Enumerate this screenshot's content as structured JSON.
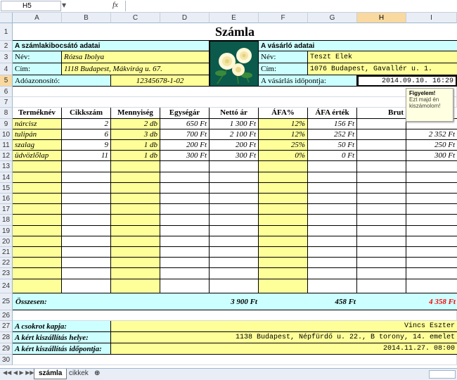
{
  "namebox": "H5",
  "fx": "fx",
  "columns": [
    "A",
    "B",
    "C",
    "D",
    "E",
    "F",
    "G",
    "H",
    "I"
  ],
  "rows": [
    "1",
    "2",
    "3",
    "4",
    "5",
    "6",
    "7",
    "8",
    "9",
    "10",
    "11",
    "12",
    "13",
    "14",
    "15",
    "16",
    "17",
    "18",
    "19",
    "20",
    "21",
    "22",
    "23",
    "24",
    "25",
    "26",
    "27",
    "28",
    "29",
    "30"
  ],
  "title": "Számla",
  "seller": {
    "header": "A számlakibocsátó adatai",
    "name_label": "Név:",
    "name": "Rózsa Ibolya",
    "address_label": "Cím:",
    "address": "1118 Budapest, Mákvirág u. 67.",
    "tax_label": "Adóazonosító:",
    "tax": "12345678-1-02"
  },
  "buyer": {
    "header": "A vásárló adatai",
    "name_label": "Név:",
    "name": "Teszt Elek",
    "address_label": "Cím:",
    "address": "1076 Budapest, Gavallér u. 1.",
    "time_label": "A vásárlás időpontja:",
    "time": "2014.09.10. 16:29"
  },
  "table": {
    "headers": [
      "Terméknév",
      "Cikkszám",
      "Mennyiség",
      "Egységár",
      "Nettó ár",
      "ÁFA%",
      "ÁFA érték",
      "Brut"
    ],
    "rows": [
      [
        "nárcisz",
        "2",
        "2 db",
        "650 Ft",
        "1 300 Ft",
        "12%",
        "156 Ft",
        ""
      ],
      [
        "tulipán",
        "6",
        "3 db",
        "700 Ft",
        "2 100 Ft",
        "12%",
        "252 Ft",
        "2 352 Ft"
      ],
      [
        "szalag",
        "9",
        "1 db",
        "200 Ft",
        "200 Ft",
        "25%",
        "50 Ft",
        "250 Ft"
      ],
      [
        "üdvözlőlap",
        "11",
        "1 db",
        "300 Ft",
        "300 Ft",
        "0%",
        "0 Ft",
        "300 Ft"
      ]
    ]
  },
  "totals": {
    "label": "Összesen:",
    "net": "3 900 Ft",
    "vat": "458 Ft",
    "gross": "4 358 Ft"
  },
  "delivery": {
    "recipient_label": "A csokrot kapja:",
    "recipient": "Vincs Eszter",
    "place_label": "A kért kiszállítás helye:",
    "place": "1138 Budapest,  Népfürdő u. 22., B torony, 14. emelet",
    "time_label": "A kért kiszállítás időpontja:",
    "time": "2014.11.27. 08:00"
  },
  "tooltip": {
    "title": "Figyelem!",
    "text": "Ezt majd én kiszámolom!"
  },
  "sheets": [
    "számla",
    "cikkek"
  ],
  "colors": {
    "yellow": "#ffff99",
    "cyan": "#ccffff",
    "total_red": "#ff0000"
  }
}
